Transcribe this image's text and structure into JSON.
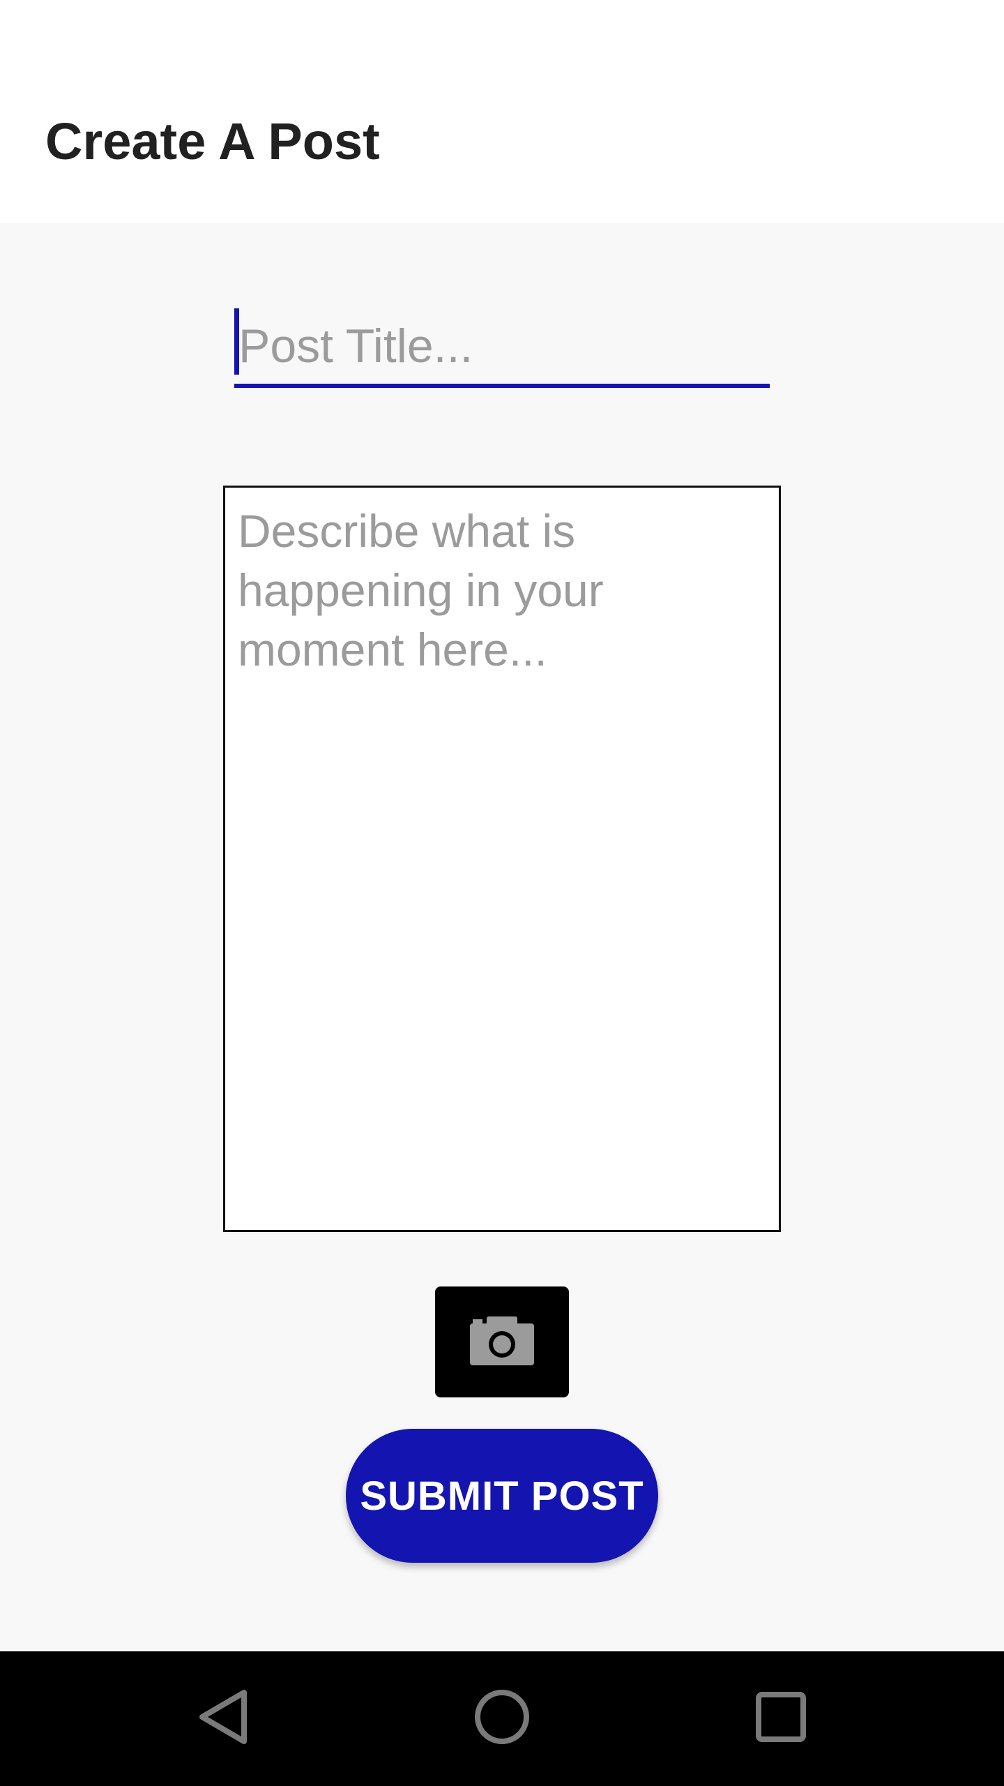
{
  "app_bar": {
    "title": "Create A Post"
  },
  "form": {
    "title_placeholder": "Post Title...",
    "title_value": "",
    "description_placeholder": "Describe what is happening in your moment here...",
    "description_value": "",
    "camera_icon": "camera-icon",
    "submit_label": "SUBMIT POST"
  },
  "navigation": {
    "back_icon": "back-triangle-icon",
    "home_icon": "home-circle-icon",
    "recents_icon": "recents-square-icon"
  },
  "colors": {
    "accent": "#1414b0",
    "placeholder": "#9b9b9b",
    "background": "#f8f8f8",
    "nav_bar": "#000000",
    "nav_icon": "#7a7a7a"
  }
}
